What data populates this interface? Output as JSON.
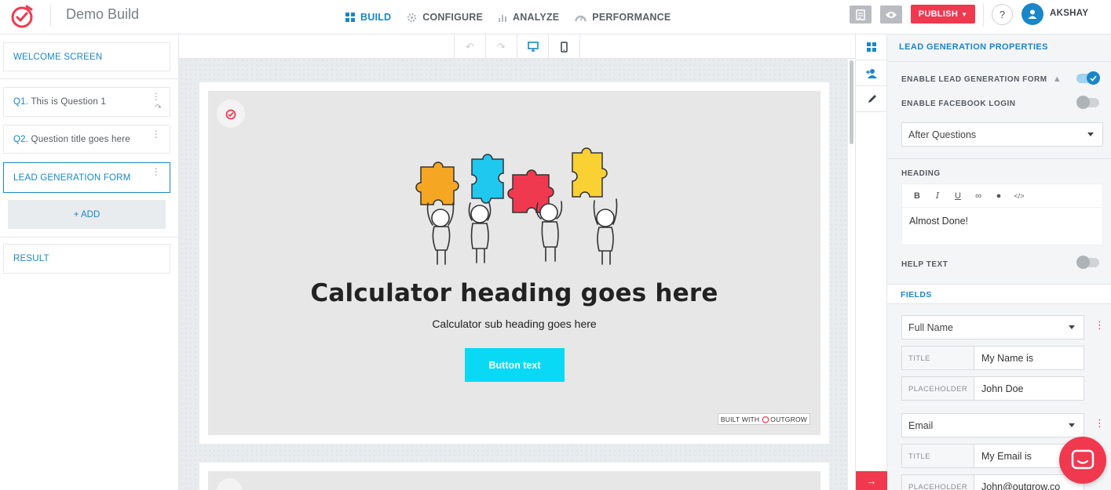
{
  "app": {
    "title": "Demo Build"
  },
  "nav": [
    {
      "label": "BUILD",
      "icon": "grid-icon",
      "active": true
    },
    {
      "label": "CONFIGURE",
      "icon": "gear-icon",
      "active": false
    },
    {
      "label": "ANALYZE",
      "icon": "bar-chart-icon",
      "active": false
    },
    {
      "label": "PERFORMANCE",
      "icon": "gauge-icon",
      "active": false
    }
  ],
  "topbar": {
    "publish_label": "PUBLISH",
    "help_label": "?",
    "username": "AKSHAY"
  },
  "sidebar": {
    "welcome": "WELCOME SCREEN",
    "questions": [
      {
        "num": "Q1.",
        "text": "This is Question 1"
      },
      {
        "num": "Q2.",
        "text": "Question title goes here"
      }
    ],
    "lead_form": "LEAD GENERATION FORM",
    "add_label": "+ ADD",
    "result": "RESULT"
  },
  "preview": {
    "heading": "Calculator heading goes here",
    "subheading": "Calculator sub heading goes here",
    "button_text": "Button text",
    "badge_prefix": "BUILT WITH",
    "badge_brand": "OUTGROW"
  },
  "props": {
    "title": "LEAD GENERATION PROPERTIES",
    "enable_lead_form": {
      "label": "ENABLE LEAD GENERATION FORM",
      "on": true
    },
    "enable_facebook": {
      "label": "ENABLE FACEBOOK LOGIN",
      "on": false
    },
    "position_select": "After Questions",
    "heading_label": "HEADING",
    "heading_content": "Almost Done!",
    "help_text": {
      "label": "HELP TEXT",
      "on": false
    },
    "fields_title": "FIELDS",
    "fields": [
      {
        "type": "Full Name",
        "title_label": "TITLE",
        "title_value": "My Name is",
        "placeholder_label": "PLACEHOLDER",
        "placeholder_value": "John Doe"
      },
      {
        "type": "Email",
        "title_label": "TITLE",
        "title_value": "My Email is",
        "placeholder_label": "PLACEHOLDER",
        "placeholder_value": "John@outgrow.co"
      }
    ]
  },
  "colors": {
    "accent": "#1a86c8",
    "brand_red": "#f0394f",
    "cta_cyan": "#0ad9f5"
  }
}
